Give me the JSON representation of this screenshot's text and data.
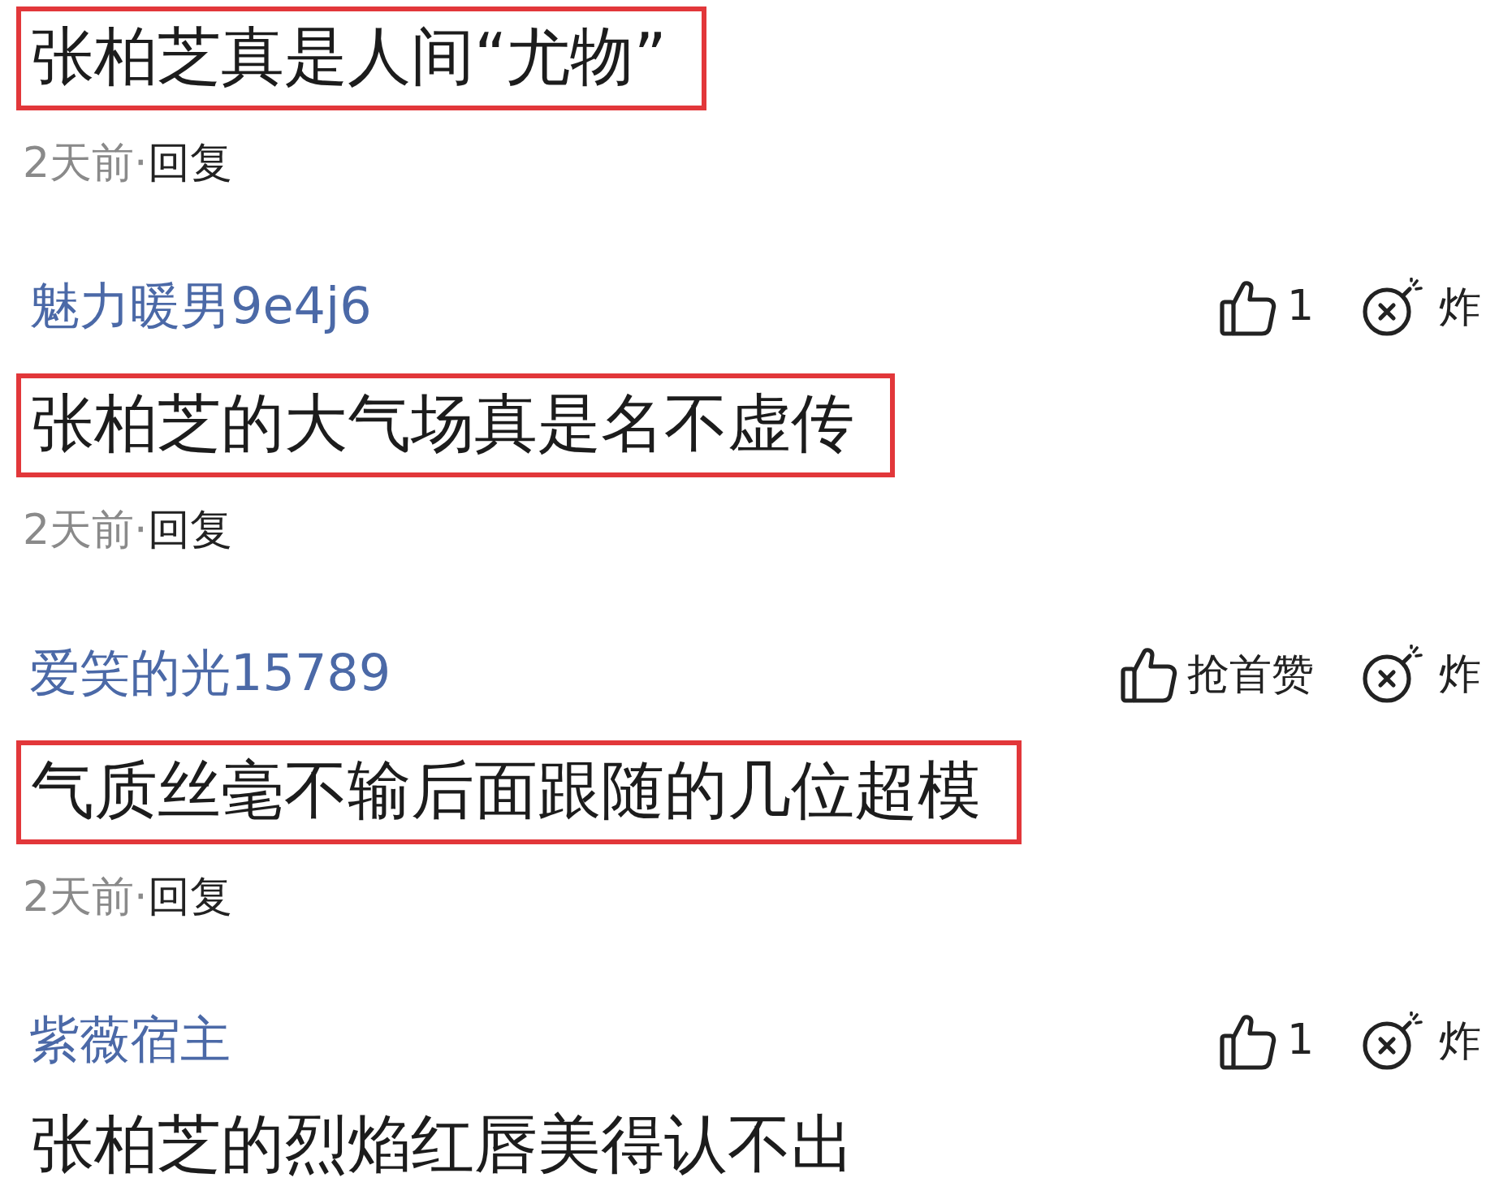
{
  "comments": [
    {
      "text": "张柏芝真是人间“尤物”",
      "highlighted": true,
      "time": "2天前·",
      "reply": "回复"
    },
    {
      "username": "魅力暖男9e4j6",
      "like": "1",
      "bomb": "炸",
      "text": "张柏芝的大气场真是名不虚传",
      "highlighted": true,
      "time": "2天前·",
      "reply": "回复"
    },
    {
      "username": "爱笑的光15789",
      "like": "抢首赞",
      "bomb": "炸",
      "text": "气质丝毫不输后面跟随的几位超模",
      "highlighted": true,
      "time": "2天前·",
      "reply": "回复"
    },
    {
      "username": "紫薇宿主",
      "like": "1",
      "bomb": "炸",
      "text": "张柏芝的烈焰红唇美得认不出",
      "highlighted": false
    }
  ]
}
